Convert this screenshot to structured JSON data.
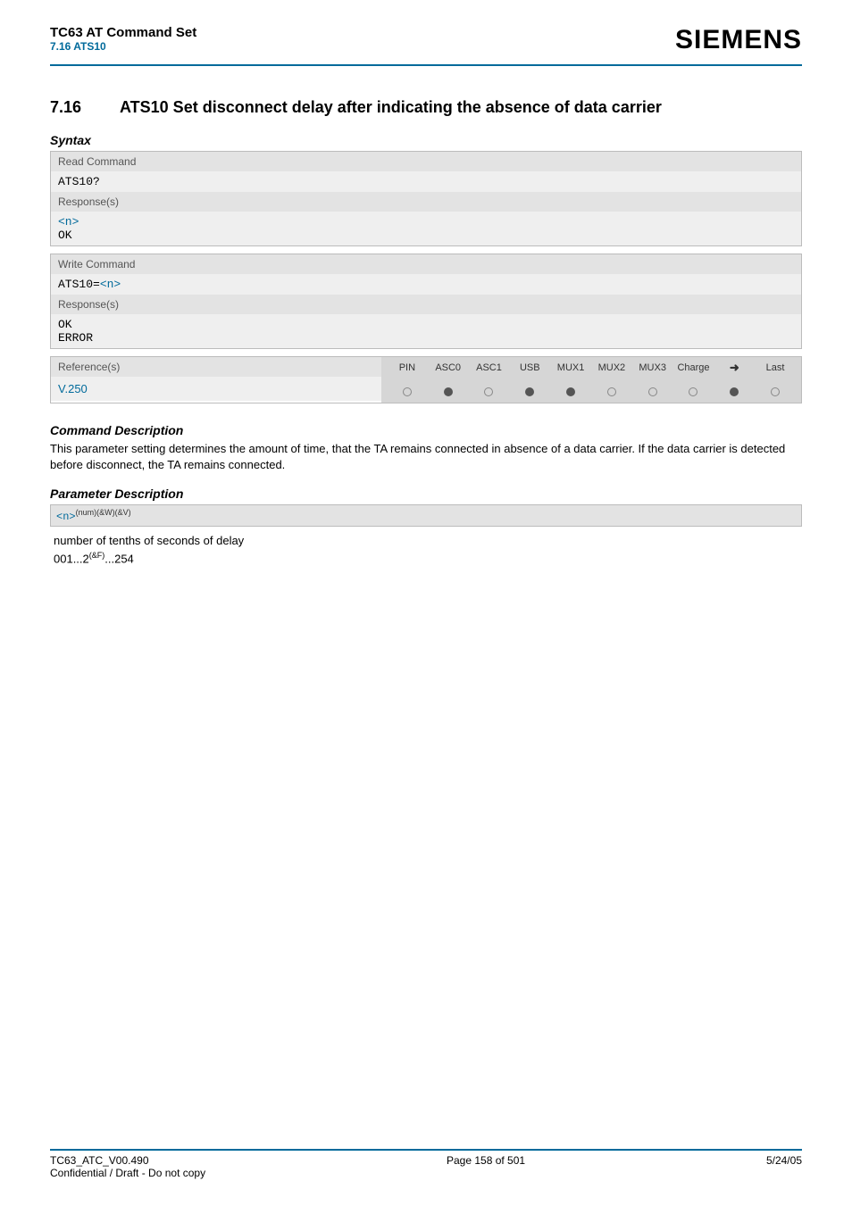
{
  "header": {
    "doc_title": "TC63 AT Command Set",
    "doc_subtitle": "7.16 ATS10",
    "logo_text": "SIEMENS"
  },
  "section": {
    "number": "7.16",
    "title": "ATS10   Set disconnect delay after indicating the absence of data carrier"
  },
  "syntax_label": "Syntax",
  "read_box": {
    "label": "Read Command",
    "command": "ATS10?",
    "response_label": "Response(s)",
    "response_param": "<n>",
    "response_ok": "OK"
  },
  "write_box": {
    "label": "Write Command",
    "command_prefix": "ATS10=",
    "command_param": "<n>",
    "response_label": "Response(s)",
    "response_ok": "OK",
    "response_error": "ERROR"
  },
  "ref_box": {
    "label": "Reference(s)",
    "value": "V.250",
    "columns": [
      "PIN",
      "ASC0",
      "ASC1",
      "USB",
      "MUX1",
      "MUX2",
      "MUX3",
      "Charge",
      "➜",
      "Last"
    ],
    "states": [
      "empty",
      "filled",
      "empty",
      "filled",
      "filled",
      "empty",
      "empty",
      "empty",
      "filled",
      "empty"
    ]
  },
  "cmd_desc_heading": "Command Description",
  "cmd_desc_text": "This parameter setting determines the amount of time, that the TA remains connected in absence of a data carrier. If the data carrier is detected before disconnect, the TA remains connected.",
  "param_desc_heading": "Parameter Description",
  "param_box": {
    "name": "<n>",
    "attrs": "(num)(&W)(&V)"
  },
  "param_text": {
    "line1": "number of tenths of seconds of delay",
    "range_a": "001...2",
    "range_sup": "(&F)",
    "range_b": "...254"
  },
  "footer": {
    "left1": "TC63_ATC_V00.490",
    "left2": "Confidential / Draft - Do not copy",
    "center": "Page 158 of 501",
    "right": "5/24/05"
  }
}
